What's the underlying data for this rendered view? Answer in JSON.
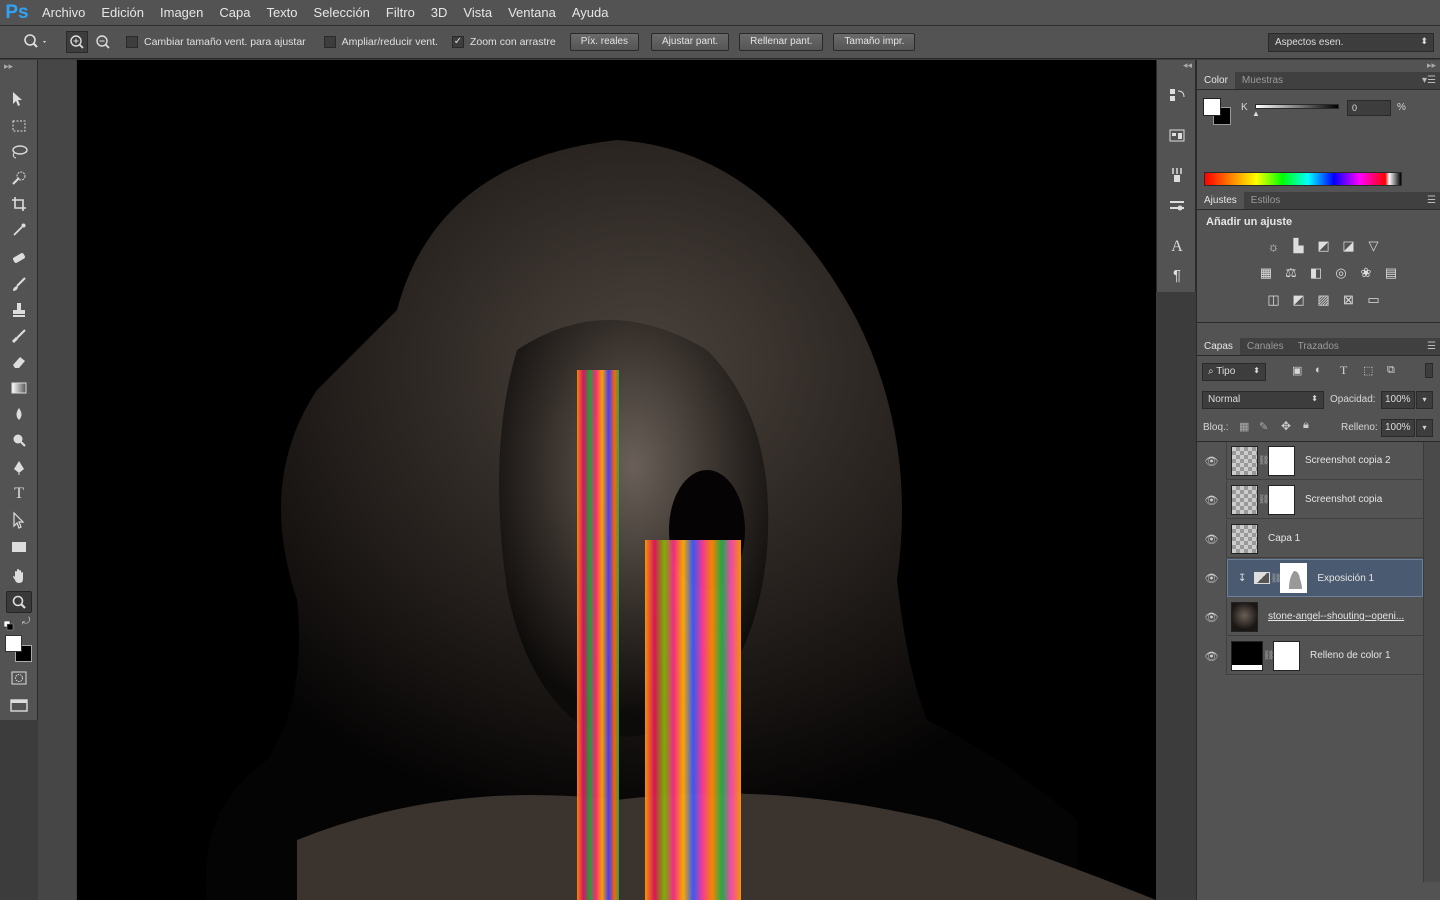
{
  "app": {
    "logo": "Ps"
  },
  "menu": [
    "Archivo",
    "Edición",
    "Imagen",
    "Capa",
    "Texto",
    "Selección",
    "Filtro",
    "3D",
    "Vista",
    "Ventana",
    "Ayuda"
  ],
  "options": {
    "check_resize": "Cambiar tamaño vent. para ajustar",
    "check_zoom_all": "Ampliar/reducir vent.",
    "check_scrubby": "Zoom con arrastre",
    "btn_actual": "Píx. reales",
    "btn_fit": "Ajustar pant.",
    "btn_fill": "Rellenar pant.",
    "btn_print": "Tamaño impr.",
    "workspace": "Aspectos esen."
  },
  "color_panel": {
    "tab_color": "Color",
    "tab_swatches": "Muestras",
    "channel": "K",
    "value": "0",
    "unit": "%"
  },
  "adjust_panel": {
    "tab_adjust": "Ajustes",
    "tab_styles": "Estilos",
    "title": "Añadir un ajuste"
  },
  "layers_panel": {
    "tab_layers": "Capas",
    "tab_channels": "Canales",
    "tab_paths": "Trazados",
    "filter": "Tipo",
    "blend": "Normal",
    "opacity_label": "Opacidad:",
    "opacity": "100%",
    "lock_label": "Bloq.:",
    "fill_label": "Relleno:",
    "fill": "100%",
    "layers": [
      {
        "name": "Screenshot copia 2"
      },
      {
        "name": "Screenshot copia"
      },
      {
        "name": "Capa 1"
      },
      {
        "name": "Exposición 1"
      },
      {
        "name": "stone-angel--shouting--openi..."
      },
      {
        "name": "Relleno de color 1"
      }
    ]
  }
}
